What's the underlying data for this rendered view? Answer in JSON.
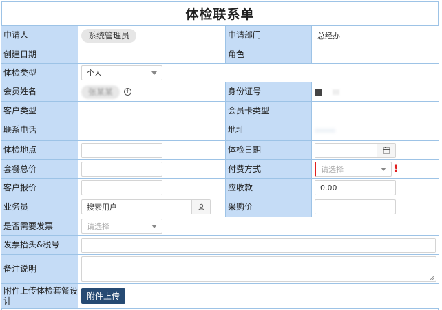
{
  "title": "体检联系单",
  "rows": [
    {
      "l1": "申请人",
      "v1": "系统管理员",
      "l2": "申请部门",
      "v2": "总经办"
    },
    {
      "l1": "创建日期",
      "v1": "",
      "l2": "角色",
      "v2": ""
    },
    {
      "l1": "体检类型",
      "v1": "个人"
    },
    {
      "l1": "会员姓名",
      "v1": "张某某",
      "l2": "身份证号",
      "v2": ""
    },
    {
      "l1": "客户类型",
      "v1": "",
      "l2": "会员卡类型",
      "v2": ""
    },
    {
      "l1": "联系电话",
      "v1": "",
      "l2": "地址",
      "v2": ""
    },
    {
      "l1": "体检地点",
      "v1": "",
      "l2": "体检日期",
      "v2": ""
    },
    {
      "l1": "套餐总价",
      "v1": "",
      "l2": "付费方式",
      "v2": "请选择"
    },
    {
      "l1": "客户报价",
      "v1": "",
      "l2": "应收款",
      "v2": "0.00"
    },
    {
      "l1": "业务员",
      "v1": "搜索用户",
      "l2": "采购价",
      "v2": ""
    },
    {
      "l1": "是否需要发票",
      "v1": "请选择"
    },
    {
      "l1": "发票抬头&税号",
      "v1": ""
    },
    {
      "l1": "备注说明",
      "v1": ""
    },
    {
      "l1": "附件上传体检套餐设计",
      "v1": "附件上传"
    }
  ],
  "icons": {
    "add": "plus-circle-icon",
    "calendar": "calendar-icon",
    "user": "user-icon",
    "required": "!"
  },
  "colors": {
    "label_bg": "#c5dcf6",
    "border": "#9dc3e6",
    "button_bg": "#264a73",
    "required": "#e02020"
  }
}
